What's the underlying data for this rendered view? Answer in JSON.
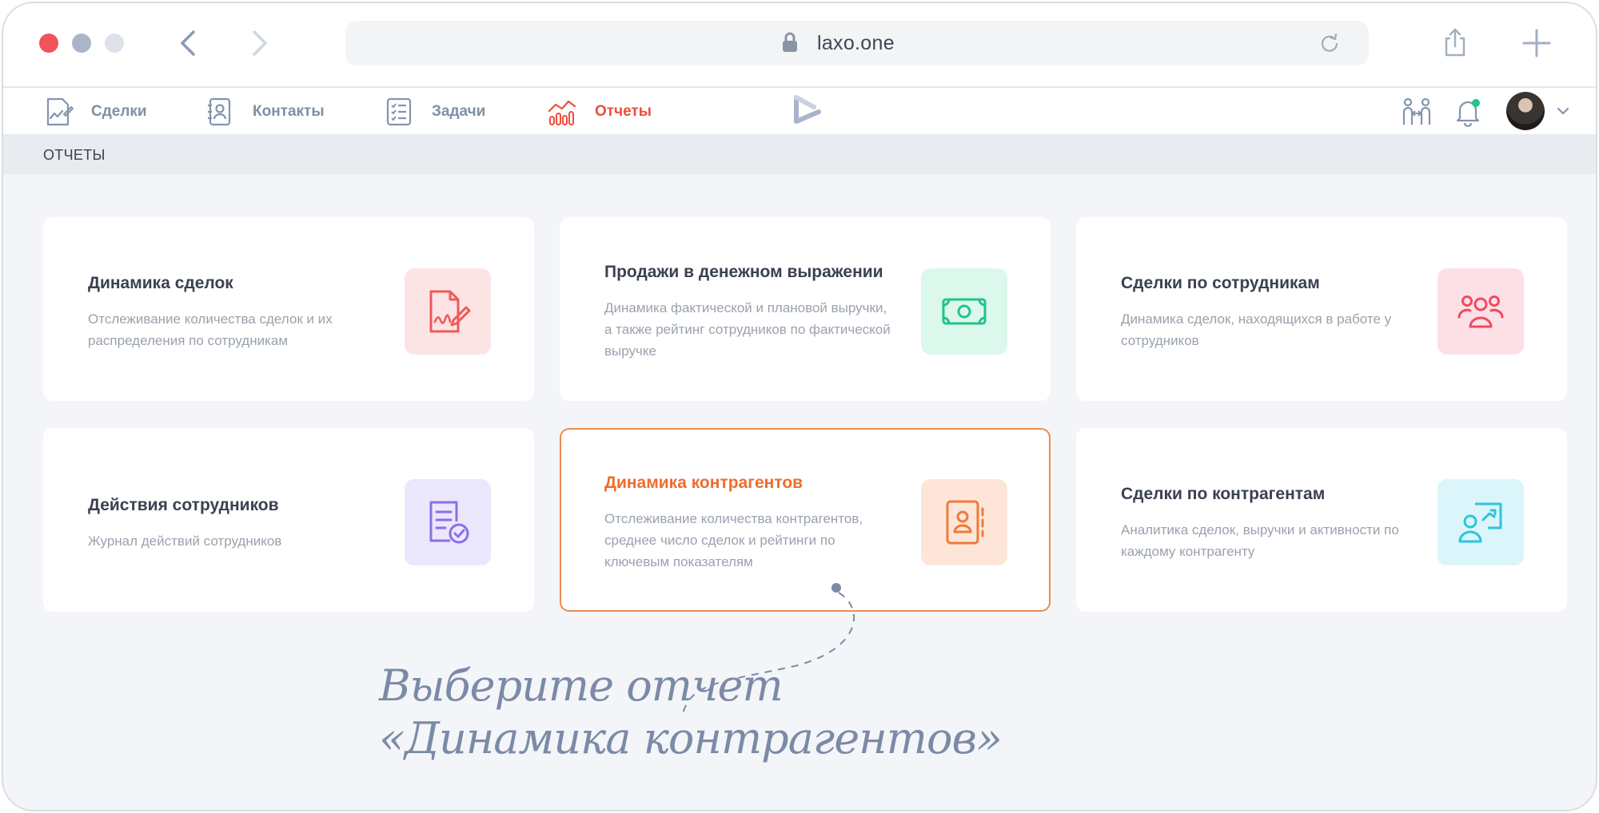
{
  "browser": {
    "url": "laxo.one"
  },
  "nav": {
    "items": [
      {
        "label": "Сделки",
        "icon": "deal-document-icon"
      },
      {
        "label": "Контакты",
        "icon": "contact-card-icon"
      },
      {
        "label": "Задачи",
        "icon": "checklist-icon"
      },
      {
        "label": "Отчеты",
        "icon": "chart-bars-icon",
        "active": true
      }
    ],
    "active_color": "#ee4d3a"
  },
  "section": {
    "title": "ОТЧЕТЫ"
  },
  "cards": [
    {
      "title": "Динамика сделок",
      "description": "Отслеживание количества сделок и их распределения по сотрудникам",
      "icon": "signed-document-icon",
      "icon_bg": "#fde4e4",
      "icon_color": "#ef5a5a"
    },
    {
      "title": "Продажи в денежном выражении",
      "description": "Динамика фактической и плановой выручки, а также рейтинг сотрудников по фактической выручке",
      "icon": "banknote-icon",
      "icon_bg": "#dcf7ec",
      "icon_color": "#22c48c"
    },
    {
      "title": "Сделки по сотрудникам",
      "description": "Динамика сделок, находящихся в работе у сотрудников",
      "icon": "people-group-icon",
      "icon_bg": "#fde0e6",
      "icon_color": "#ef4a63"
    },
    {
      "title": "Действия сотрудников",
      "description": "Журнал действий сотрудников",
      "icon": "document-check-icon",
      "icon_bg": "#ebe7fc",
      "icon_color": "#8b6ee8"
    },
    {
      "title": "Динамика контрагентов",
      "description": "Отслеживание количества контрагентов, среднее число сделок и рейтинги по ключевым показателям",
      "icon": "address-book-icon",
      "icon_bg": "#fde6d9",
      "icon_color": "#f07a3a",
      "selected": true
    },
    {
      "title": "Сделки по контрагентам",
      "description": "Аналитика сделок, выручки и активности по каждому контрагенту",
      "icon": "user-presentation-icon",
      "icon_bg": "#dbf5fa",
      "icon_color": "#2bc5dc"
    }
  ],
  "annotation": {
    "line1": "Выберите отчет",
    "line2": "«Динамика контрагентов»"
  }
}
